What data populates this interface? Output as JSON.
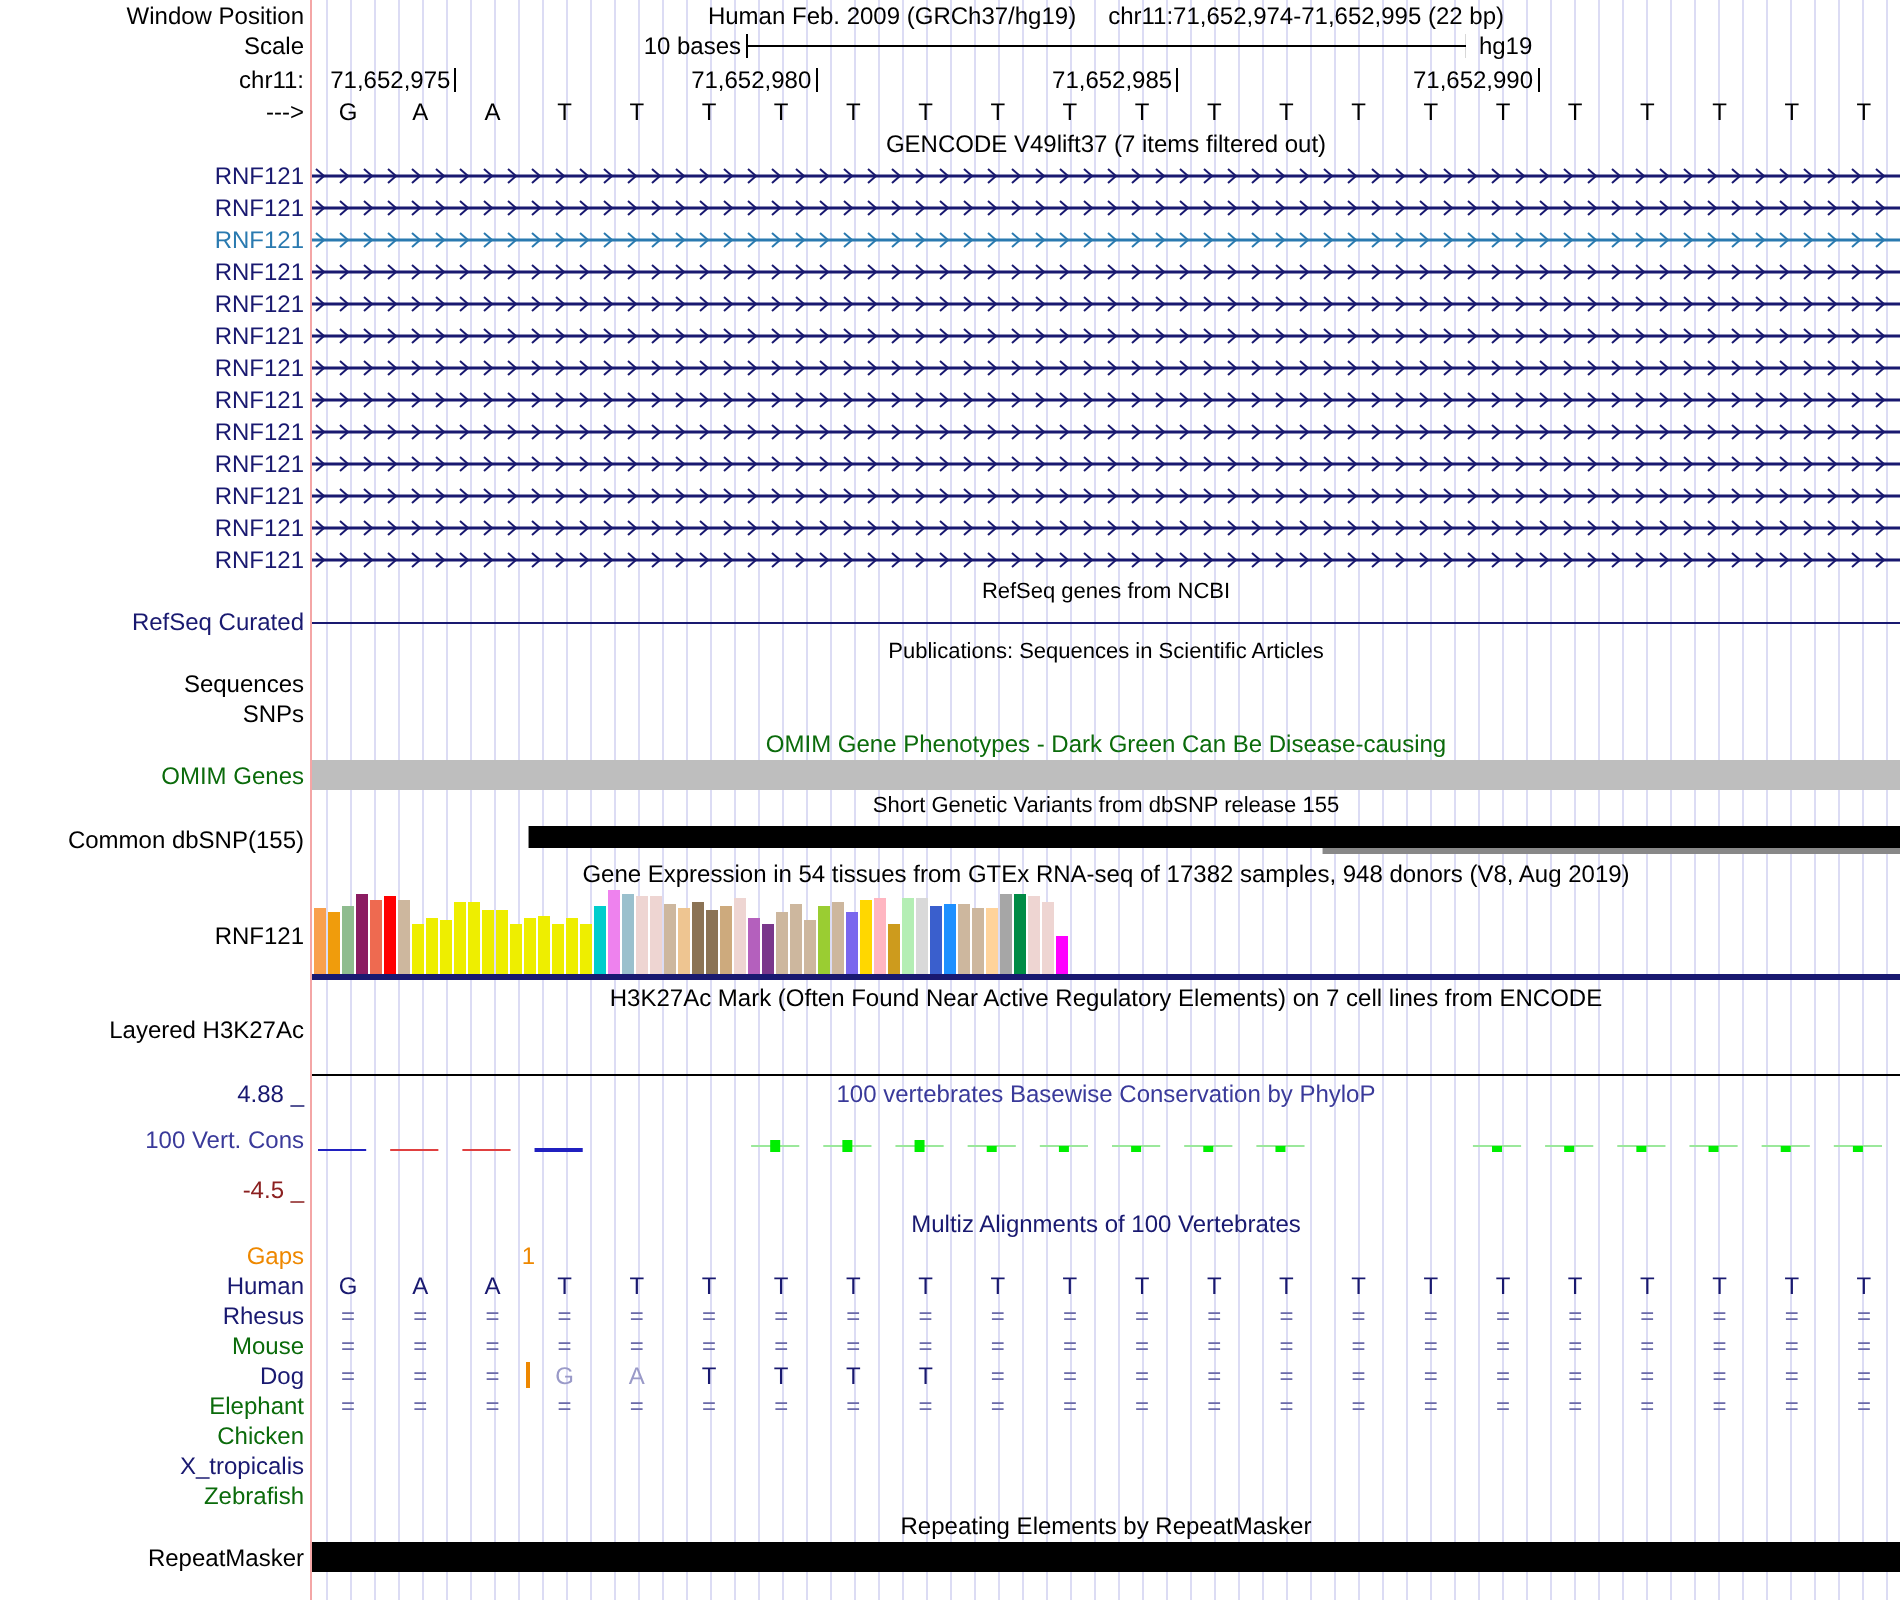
{
  "header": {
    "window_position": {
      "label": "Window Position",
      "assembly": "Human Feb. 2009 (GRCh37/hg19)",
      "range": "chr11:71,652,974-71,652,995 (22 bp)"
    },
    "scale": {
      "label": "Scale",
      "span": "10 bases",
      "database": "hg19"
    },
    "ruler": {
      "label": "chr11:",
      "ticks": [
        "71,652,975",
        "71,652,980",
        "71,652,985",
        "71,652,990"
      ]
    },
    "sequence": {
      "label": "--->",
      "bases": [
        "G",
        "A",
        "A",
        "T",
        "T",
        "T",
        "T",
        "T",
        "T",
        "T",
        "T",
        "T",
        "T",
        "T",
        "T",
        "T",
        "T",
        "T",
        "T",
        "T",
        "T",
        "T"
      ]
    }
  },
  "tracks": [
    {
      "kind": "gencode",
      "title": "GENCODE V49lift37 (7 items filtered out)",
      "items": [
        {
          "label": "RNF121",
          "highlighted": false
        },
        {
          "label": "RNF121",
          "highlighted": false
        },
        {
          "label": "RNF121",
          "highlighted": true
        },
        {
          "label": "RNF121",
          "highlighted": false
        },
        {
          "label": "RNF121",
          "highlighted": false
        },
        {
          "label": "RNF121",
          "highlighted": false
        },
        {
          "label": "RNF121",
          "highlighted": false
        },
        {
          "label": "RNF121",
          "highlighted": false
        },
        {
          "label": "RNF121",
          "highlighted": false
        },
        {
          "label": "RNF121",
          "highlighted": false
        },
        {
          "label": "RNF121",
          "highlighted": false
        },
        {
          "label": "RNF121",
          "highlighted": false
        },
        {
          "label": "RNF121",
          "highlighted": false
        }
      ]
    },
    {
      "kind": "refseq",
      "title": "RefSeq genes from NCBI",
      "label": "RefSeq Curated"
    },
    {
      "kind": "publications",
      "title": "Publications: Sequences in Scientific Articles",
      "labels": [
        "Sequences",
        "SNPs"
      ]
    },
    {
      "kind": "omim",
      "title": "OMIM Gene Phenotypes - Dark Green Can Be Disease-causing",
      "label": "OMIM Genes"
    },
    {
      "kind": "dbsnp",
      "title": "Short Genetic Variants from dbSNP release 155",
      "label": "Common dbSNP(155)"
    },
    {
      "kind": "gtex",
      "title": "Gene Expression in 54 tissues from GTEx RNA-seq of 17382 samples, 948 donors (V8, Aug 2019)",
      "label": "RNF121",
      "bars": [
        {
          "color": "#f9a04c"
        },
        {
          "color": "#f09c0c"
        },
        {
          "color": "#8fbc8f"
        },
        {
          "color": "#8b1c62"
        },
        {
          "color": "#ee6a50"
        },
        {
          "color": "#ff0000"
        },
        {
          "color": "#cdb79e"
        },
        {
          "color": "#eeee00"
        },
        {
          "color": "#eeee00"
        },
        {
          "color": "#eeee00"
        },
        {
          "color": "#eeee00"
        },
        {
          "color": "#eeee00"
        },
        {
          "color": "#eeee00"
        },
        {
          "color": "#eeee00"
        },
        {
          "color": "#eeee00"
        },
        {
          "color": "#eeee00"
        },
        {
          "color": "#eeee00"
        },
        {
          "color": "#eeee00"
        },
        {
          "color": "#eeee00"
        },
        {
          "color": "#eeee00"
        },
        {
          "color": "#00cdcd"
        },
        {
          "color": "#ee82ee"
        },
        {
          "color": "#9ac0cd"
        },
        {
          "color": "#eed5d2"
        },
        {
          "color": "#eed5d2"
        },
        {
          "color": "#cdb79e"
        },
        {
          "color": "#eec591"
        },
        {
          "color": "#8b7355"
        },
        {
          "color": "#8b7355"
        },
        {
          "color": "#cdaa7d"
        },
        {
          "color": "#eed5d2"
        },
        {
          "color": "#b460bd"
        },
        {
          "color": "#7a378b"
        },
        {
          "color": "#cdb79e"
        },
        {
          "color": "#cdb79e"
        },
        {
          "color": "#cdb79e"
        },
        {
          "color": "#9acd32"
        },
        {
          "color": "#cdb79e"
        },
        {
          "color": "#7a67ee"
        },
        {
          "color": "#ffd700"
        },
        {
          "color": "#ffb6c1"
        },
        {
          "color": "#cd9b1d"
        },
        {
          "color": "#b4eeb4"
        },
        {
          "color": "#d9d9d9"
        },
        {
          "color": "#3a5fcd"
        },
        {
          "color": "#1e90ff"
        },
        {
          "color": "#cdb79e"
        },
        {
          "color": "#cdb79e"
        },
        {
          "color": "#ffd39b"
        },
        {
          "color": "#a6a6a6"
        },
        {
          "color": "#008b45"
        },
        {
          "color": "#eed5d2"
        },
        {
          "color": "#eed5d2"
        },
        {
          "color": "#ff00ff"
        }
      ]
    },
    {
      "kind": "h3k27ac",
      "title": "H3K27Ac Mark (Often Found Near Active Regulatory Elements) on 7 cell lines from ENCODE",
      "label": "Layered H3K27Ac"
    },
    {
      "kind": "phylop",
      "title": "100 vertebrates Basewise Conservation by PhyloP",
      "label": "100 Vert. Cons",
      "max": "4.88 _",
      "min": "-4.5 _"
    },
    {
      "kind": "multiz",
      "title": "Multiz Alignments of 100 Vertebrates",
      "gaps": {
        "label": "Gaps",
        "count": "1"
      },
      "species": [
        {
          "label": "Human",
          "color": "#191970",
          "insertion": false,
          "bases": [
            "G",
            "A",
            "A",
            "T",
            "T",
            "T",
            "T",
            "T",
            "T",
            "T",
            "T",
            "T",
            "T",
            "T",
            "T",
            "T",
            "T",
            "T",
            "T",
            "T",
            "T",
            "T"
          ]
        },
        {
          "label": "Rhesus",
          "color": "#191970",
          "insertion": false,
          "bases": [
            "=",
            "=",
            "=",
            "=",
            "=",
            "=",
            "=",
            "=",
            "=",
            "=",
            "=",
            "=",
            "=",
            "=",
            "=",
            "=",
            "=",
            "=",
            "=",
            "=",
            "=",
            "="
          ]
        },
        {
          "label": "Mouse",
          "color": "#0b6b0b",
          "insertion": false,
          "bases": [
            "=",
            "=",
            "=",
            "=",
            "=",
            "=",
            "=",
            "=",
            "=",
            "=",
            "=",
            "=",
            "=",
            "=",
            "=",
            "=",
            "=",
            "=",
            "=",
            "=",
            "=",
            "="
          ]
        },
        {
          "label": "Dog",
          "color": "#191970",
          "insertion": true,
          "bases": [
            "=",
            "=",
            "=",
            "G",
            "A",
            "T",
            "T",
            "T",
            "T",
            "=",
            "=",
            "=",
            "=",
            "=",
            "=",
            "=",
            "=",
            "=",
            "=",
            "=",
            "=",
            "="
          ]
        },
        {
          "label": "Elephant",
          "color": "#0b6b0b",
          "insertion": false,
          "bases": [
            "=",
            "=",
            "=",
            "=",
            "=",
            "=",
            "=",
            "=",
            "=",
            "=",
            "=",
            "=",
            "=",
            "=",
            "=",
            "=",
            "=",
            "=",
            "=",
            "=",
            "=",
            "="
          ]
        },
        {
          "label": "Chicken",
          "color": "#0b6b0b",
          "insertion": false
        },
        {
          "label": "X_tropicalis",
          "color": "#191970",
          "insertion": false
        },
        {
          "label": "Zebrafish",
          "color": "#0b6b0b",
          "insertion": false
        }
      ]
    },
    {
      "kind": "repeatmasker",
      "title": "Repeating Elements by RepeatMasker",
      "label": "RepeatMasker"
    }
  ]
}
